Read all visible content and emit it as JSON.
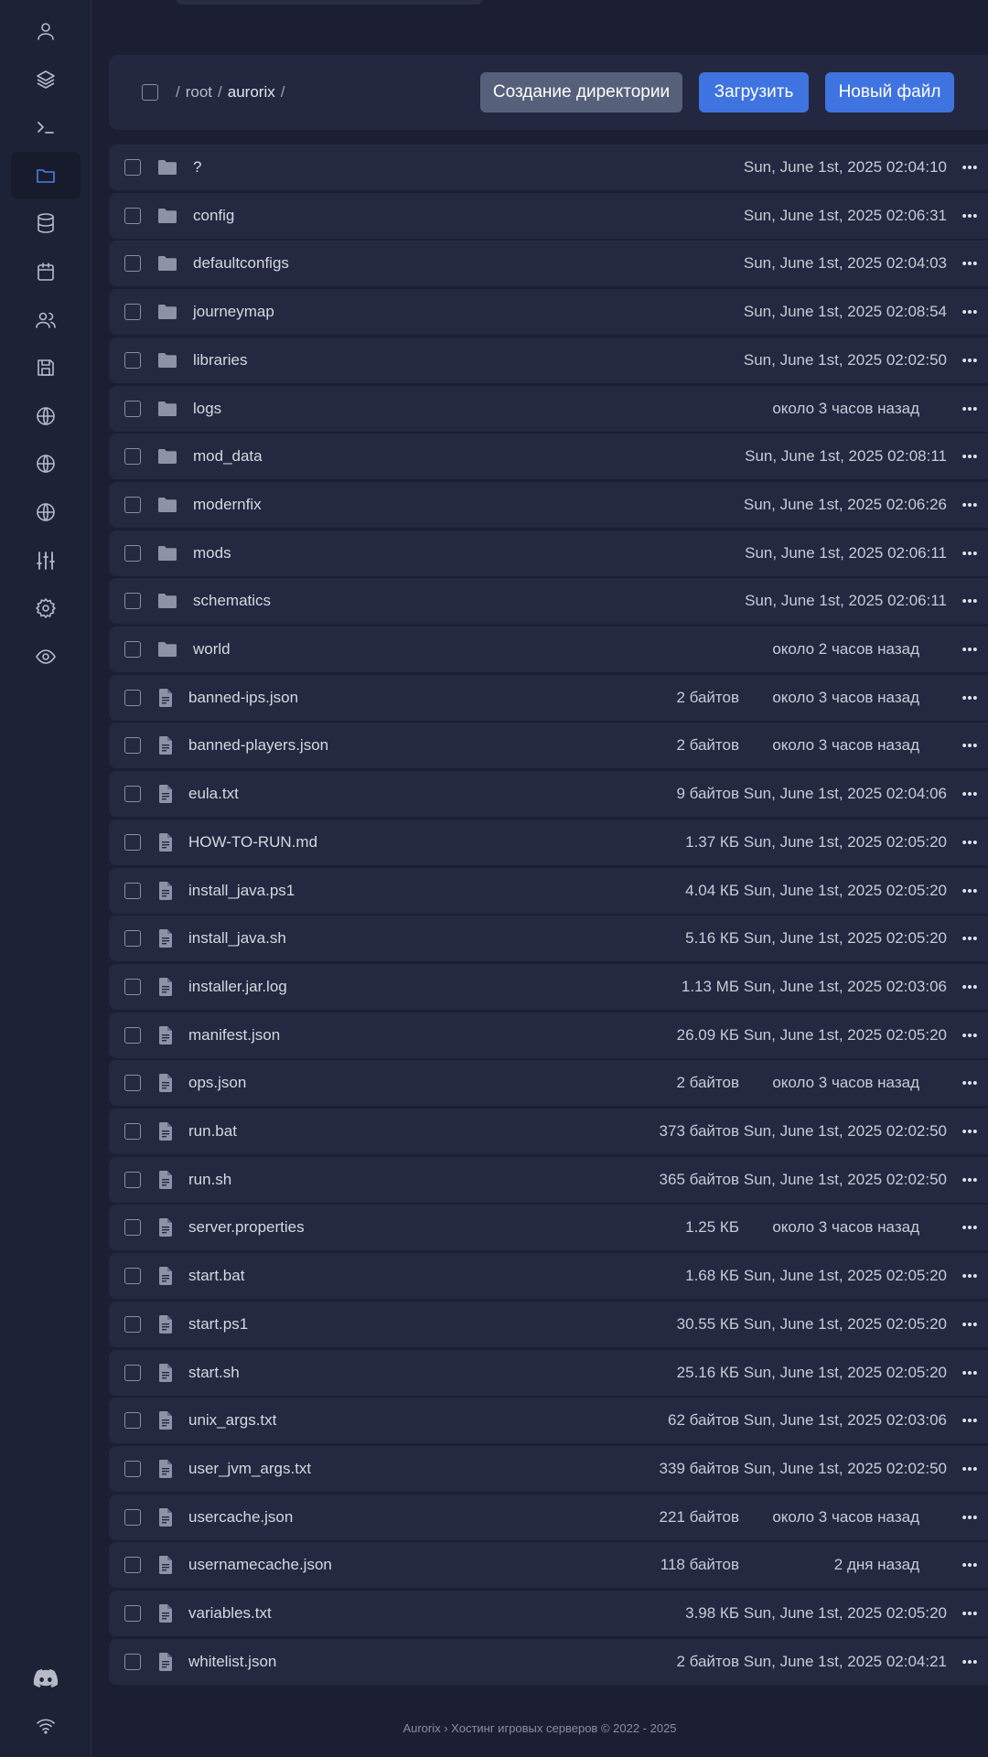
{
  "sidebar": {
    "items": [
      {
        "icon": "user-icon",
        "active": false
      },
      {
        "icon": "layers-icon",
        "active": false
      },
      {
        "icon": "terminal-icon",
        "active": false
      },
      {
        "icon": "folder-icon",
        "active": true
      },
      {
        "icon": "database-icon",
        "active": false
      },
      {
        "icon": "calendar-icon",
        "active": false
      },
      {
        "icon": "users-icon",
        "active": false
      },
      {
        "icon": "save-icon",
        "active": false
      },
      {
        "icon": "globe-icon",
        "active": false
      },
      {
        "icon": "globe-icon",
        "active": false
      },
      {
        "icon": "globe-icon",
        "active": false
      },
      {
        "icon": "sliders-icon",
        "active": false
      },
      {
        "icon": "gear-icon",
        "active": false
      },
      {
        "icon": "eye-icon",
        "active": false
      }
    ],
    "bottom": [
      "discord-icon",
      "wifi-icon"
    ]
  },
  "toolbar": {
    "breadcrumb": [
      "root",
      "aurorix"
    ],
    "create_dir_label": "Создание директории",
    "upload_label": "Загрузить",
    "new_file_label": "Новый файл"
  },
  "files": [
    {
      "name": "?",
      "type": "folder",
      "size": "",
      "modified": "Sun, June 1st, 2025 02:04:10"
    },
    {
      "name": "config",
      "type": "folder",
      "size": "",
      "modified": "Sun, June 1st, 2025 02:06:31"
    },
    {
      "name": "defaultconfigs",
      "type": "folder",
      "size": "",
      "modified": "Sun, June 1st, 2025 02:04:03"
    },
    {
      "name": "journeymap",
      "type": "folder",
      "size": "",
      "modified": "Sun, June 1st, 2025 02:08:54"
    },
    {
      "name": "libraries",
      "type": "folder",
      "size": "",
      "modified": "Sun, June 1st, 2025 02:02:50"
    },
    {
      "name": "logs",
      "type": "folder",
      "size": "",
      "modified": "около 3 часов назад"
    },
    {
      "name": "mod_data",
      "type": "folder",
      "size": "",
      "modified": "Sun, June 1st, 2025 02:08:11"
    },
    {
      "name": "modernfix",
      "type": "folder",
      "size": "",
      "modified": "Sun, June 1st, 2025 02:06:26"
    },
    {
      "name": "mods",
      "type": "folder",
      "size": "",
      "modified": "Sun, June 1st, 2025 02:06:11"
    },
    {
      "name": "schematics",
      "type": "folder",
      "size": "",
      "modified": "Sun, June 1st, 2025 02:06:11"
    },
    {
      "name": "world",
      "type": "folder",
      "size": "",
      "modified": "около 2 часов назад"
    },
    {
      "name": "banned-ips.json",
      "type": "file",
      "size": "2 байтов",
      "modified": "около 3 часов назад"
    },
    {
      "name": "banned-players.json",
      "type": "file",
      "size": "2 байтов",
      "modified": "около 3 часов назад"
    },
    {
      "name": "eula.txt",
      "type": "file",
      "size": "9 байтов",
      "modified": "Sun, June 1st, 2025 02:04:06"
    },
    {
      "name": "HOW-TO-RUN.md",
      "type": "file",
      "size": "1.37 КБ",
      "modified": "Sun, June 1st, 2025 02:05:20"
    },
    {
      "name": "install_java.ps1",
      "type": "file",
      "size": "4.04 КБ",
      "modified": "Sun, June 1st, 2025 02:05:20"
    },
    {
      "name": "install_java.sh",
      "type": "file",
      "size": "5.16 КБ",
      "modified": "Sun, June 1st, 2025 02:05:20"
    },
    {
      "name": "installer.jar.log",
      "type": "file",
      "size": "1.13 МБ",
      "modified": "Sun, June 1st, 2025 02:03:06"
    },
    {
      "name": "manifest.json",
      "type": "file",
      "size": "26.09 КБ",
      "modified": "Sun, June 1st, 2025 02:05:20"
    },
    {
      "name": "ops.json",
      "type": "file",
      "size": "2 байтов",
      "modified": "около 3 часов назад"
    },
    {
      "name": "run.bat",
      "type": "file",
      "size": "373 байтов",
      "modified": "Sun, June 1st, 2025 02:02:50"
    },
    {
      "name": "run.sh",
      "type": "file",
      "size": "365 байтов",
      "modified": "Sun, June 1st, 2025 02:02:50"
    },
    {
      "name": "server.properties",
      "type": "file",
      "size": "1.25 КБ",
      "modified": "около 3 часов назад"
    },
    {
      "name": "start.bat",
      "type": "file",
      "size": "1.68 КБ",
      "modified": "Sun, June 1st, 2025 02:05:20"
    },
    {
      "name": "start.ps1",
      "type": "file",
      "size": "30.55 КБ",
      "modified": "Sun, June 1st, 2025 02:05:20"
    },
    {
      "name": "start.sh",
      "type": "file",
      "size": "25.16 КБ",
      "modified": "Sun, June 1st, 2025 02:05:20"
    },
    {
      "name": "unix_args.txt",
      "type": "file",
      "size": "62 байтов",
      "modified": "Sun, June 1st, 2025 02:03:06"
    },
    {
      "name": "user_jvm_args.txt",
      "type": "file",
      "size": "339 байтов",
      "modified": "Sun, June 1st, 2025 02:02:50"
    },
    {
      "name": "usercache.json",
      "type": "file",
      "size": "221 байтов",
      "modified": "около 3 часов назад"
    },
    {
      "name": "usernamecache.json",
      "type": "file",
      "size": "118 байтов",
      "modified": "2 дня назад"
    },
    {
      "name": "variables.txt",
      "type": "file",
      "size": "3.98 КБ",
      "modified": "Sun, June 1st, 2025 02:05:20"
    },
    {
      "name": "whitelist.json",
      "type": "file",
      "size": "2 байтов",
      "modified": "Sun, June 1st, 2025 02:04:21"
    }
  ],
  "footer": {
    "text": "Aurorix › Хостинг игровых серверов © 2022 - 2025"
  },
  "colors": {
    "accent": "#3e73e0",
    "active_icon": "#4b80f0",
    "background": "#1c1f33",
    "row": "#242840"
  }
}
